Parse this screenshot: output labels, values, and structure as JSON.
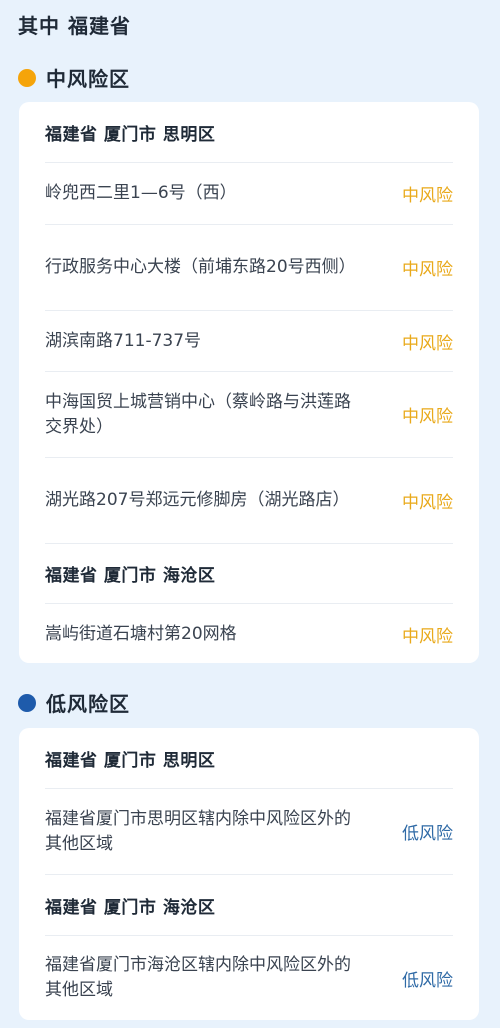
{
  "title": "其中 福建省",
  "colors": {
    "medium_dot": "#f5a40a",
    "low_dot": "#1e5bab",
    "medium_text": "#e9a91a",
    "low_text": "#2f6aa6"
  },
  "sections": [
    {
      "heading": "中风险区",
      "groups": [
        {
          "region": "福建省 厦门市 思明区",
          "items": [
            {
              "address": "岭兜西二里1—6号（西）",
              "level": "中风险"
            },
            {
              "address": "行政服务中心大楼（前埔东路20号西侧）",
              "level": "中风险"
            },
            {
              "address": "湖滨南路711-737号",
              "level": "中风险"
            },
            {
              "address": "中海国贸上城营销中心（蔡岭路与洪莲路交界处）",
              "level": "中风险"
            },
            {
              "address": "湖光路207号郑远元修脚房（湖光路店）",
              "level": "中风险"
            }
          ]
        },
        {
          "region": "福建省 厦门市 海沧区",
          "items": [
            {
              "address": "嵩屿街道石塘村第20网格",
              "level": "中风险"
            }
          ]
        }
      ]
    },
    {
      "heading": "低风险区",
      "groups": [
        {
          "region": "福建省 厦门市 思明区",
          "items": [
            {
              "address": "福建省厦门市思明区辖内除中风险区外的其他区域",
              "level": "低风险"
            }
          ]
        },
        {
          "region": "福建省 厦门市 海沧区",
          "items": [
            {
              "address": "福建省厦门市海沧区辖内除中风险区外的其他区域",
              "level": "低风险"
            }
          ]
        }
      ]
    }
  ]
}
